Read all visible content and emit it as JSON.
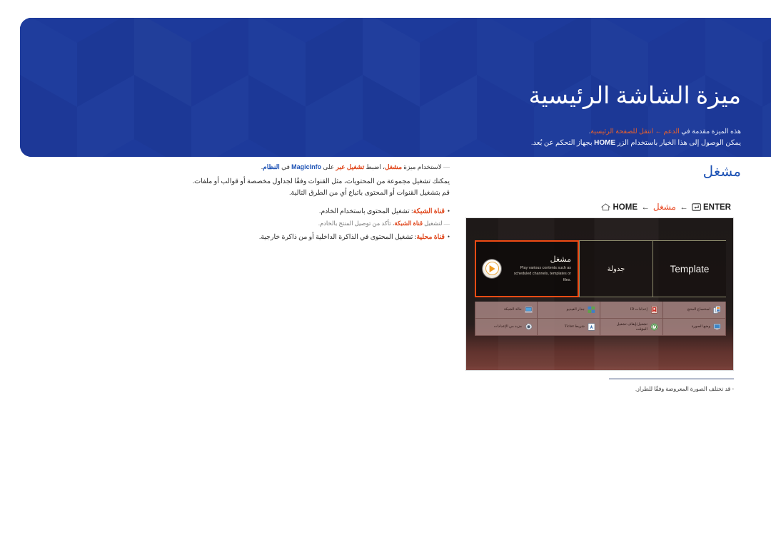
{
  "banner": {
    "title": "ميزة الشاشة الرئيسية",
    "sub1_prefix": "هذه الميزة مقدمة في ",
    "sub1_link1": "الدعم",
    "sub1_arrow": " ← ",
    "sub1_link2": "انتقل للصفحة الرئيسية",
    "sub1_suffix": ".",
    "sub2_before": "يمكن الوصول إلى هذا الخيار باستخدام الزر ",
    "sub2_key": "HOME",
    "sub2_after": " بجهاز التحكم عن بُعد.",
    "bg_color": "#1e3a9b"
  },
  "section": {
    "title": "مشغل",
    "nav_home_label": "HOME",
    "nav_home_icon": "home-icon",
    "nav_arrow": "←",
    "nav_middle_label": "مشغل",
    "nav_enter_label": "ENTER",
    "nav_enter_icon": "enter-key-icon",
    "accent_color": "#1e53b5",
    "link_color": "#e8451f"
  },
  "body": {
    "note_dash": "—",
    "note_a": "لاستخدام ميزة ",
    "note_b": "مشغل",
    "note_c": "، اضبط ",
    "note_d": "تشغيل عبر",
    "note_e": " على ",
    "note_f": "MagicInfo",
    "note_g": " في ",
    "note_h": "النظام",
    "note_i": ".",
    "line1": "يمكنك تشغيل مجموعة من المحتويات، مثل القنوات وفقًا لجداول مخصصة أو قوالب أو ملفات.",
    "line2": "قم بتشغيل القنوات أو المحتوى باتباع أي من الطرق التالية.",
    "bullets": [
      {
        "bullet": "•",
        "term": "قناة الشبكة",
        "sep": ": ",
        "text": "تشغيل المحتوى باستخدام الخادم."
      },
      {
        "bullet": "•",
        "term": "قناة محلية",
        "sep": ": ",
        "text": "تشغيل المحتوى في الذاكرة الداخلية أو من ذاكرة خارجية."
      }
    ],
    "sub_note": {
      "dash": "—",
      "a": "لتشغيل ",
      "term": "قناة الشبكة",
      "b": "، تأكد من توصيل المنتج بالخادم."
    }
  },
  "tv": {
    "top_tiles": [
      {
        "id": "template",
        "label": "Template",
        "script": "latin",
        "selected": false
      },
      {
        "id": "schedule",
        "label": "جدولة",
        "script": "arabic",
        "selected": false
      },
      {
        "id": "player",
        "label": "مشغل",
        "script": "arabic",
        "selected": true,
        "description": "Play various contents such as scheduled channels, templates or files.",
        "icon": "play-circle-icon",
        "highlight_color": "#f04b14"
      }
    ],
    "bottom_items": [
      {
        "label": "استنساخ المنتج",
        "icon": "clone-product-icon"
      },
      {
        "label": "إعدادات ID",
        "icon": "id-settings-icon"
      },
      {
        "label": "جدار الفيديو",
        "icon": "video-wall-icon"
      },
      {
        "label": "حالة الشبكة",
        "icon": "network-status-icon"
      },
      {
        "label": "وضع الصورة",
        "icon": "picture-mode-icon"
      },
      {
        "label": "تشغيل/إيقاف تشغيل المؤقت",
        "icon": "on-off-timer-icon"
      },
      {
        "label": "شريط Ticker",
        "icon": "ticker-icon"
      },
      {
        "label": "مزيد من الإعدادات",
        "icon": "more-settings-icon"
      }
    ]
  },
  "footnote": {
    "text": "- قد تختلف الصورة المعروضة وفقًا للطراز."
  }
}
